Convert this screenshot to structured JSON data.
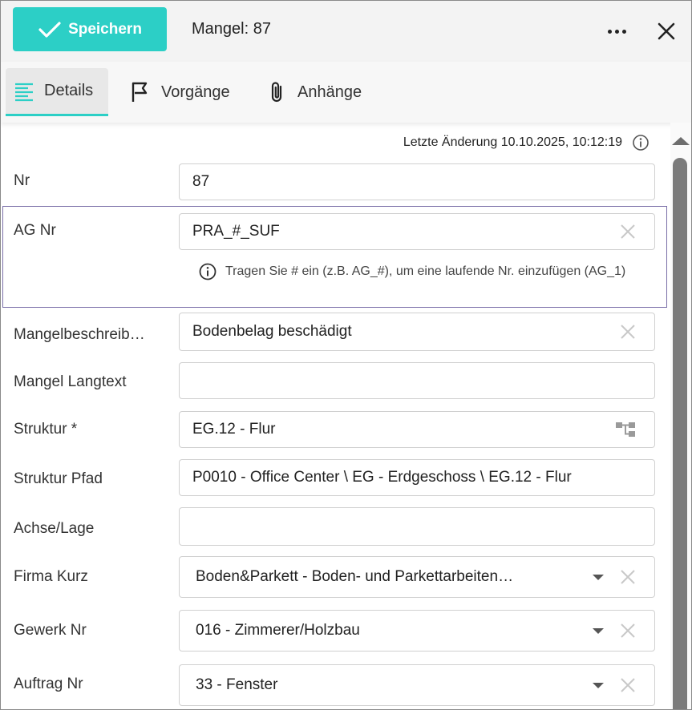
{
  "header": {
    "save_label": "Speichern",
    "title": "Mangel: 87"
  },
  "tabs": [
    {
      "label": "Details",
      "icon": "lines-icon",
      "active": true
    },
    {
      "label": "Vorgänge",
      "icon": "flag-icon",
      "active": false
    },
    {
      "label": "Anhänge",
      "icon": "paperclip-icon",
      "active": false
    }
  ],
  "last_change": "Letzte Änderung 10.10.2025, 10:12:19",
  "fields": {
    "nr": {
      "label": "Nr",
      "value": "87"
    },
    "ag_nr": {
      "label": "AG Nr",
      "value": "PRA_#_SUF",
      "hint": "Tragen Sie # ein (z.B. AG_#), um eine laufende Nr. einzufügen (AG_1)"
    },
    "mangelbeschreibung": {
      "label": "Mangelbeschreib…",
      "value": "Bodenbelag beschädigt"
    },
    "mangel_langtext": {
      "label": "Mangel Langtext",
      "value": ""
    },
    "struktur": {
      "label": "Struktur *",
      "value": "EG.12 - Flur"
    },
    "struktur_pfad": {
      "label": "Struktur Pfad",
      "value": "P0010 - Office Center \\ EG - Erdgeschoss \\ EG.12 - Flur"
    },
    "achse_lage": {
      "label": "Achse/Lage",
      "value": ""
    },
    "firma_kurz": {
      "label": "Firma Kurz",
      "value": "Boden&Parkett - Boden- und Parkettarbeiten…"
    },
    "gewerk_nr": {
      "label": "Gewerk Nr",
      "value": "016 - Zimmerer/Holzbau"
    },
    "auftrag_nr": {
      "label": "Auftrag Nr",
      "value": "33 - Fenster"
    }
  },
  "colors": {
    "accent": "#2ccfc6",
    "focus_border": "#7a6fa8"
  }
}
